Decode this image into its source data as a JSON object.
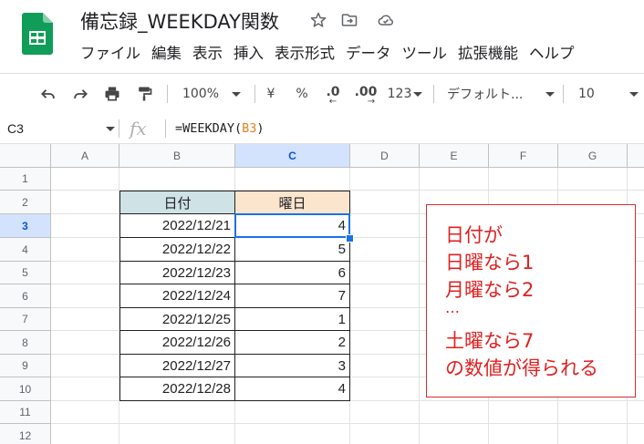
{
  "document": {
    "title": "備忘録_WEEKDAY関数"
  },
  "menu": [
    "ファイル",
    "編集",
    "表示",
    "挿入",
    "表示形式",
    "データ",
    "ツール",
    "拡張機能",
    "ヘルプ"
  ],
  "toolbar": {
    "zoom": "100%",
    "currency": "¥",
    "percent": "%",
    "decrease_decimal": ".0",
    "increase_decimal": ".00",
    "number_format": "123",
    "font": "デフォルト...",
    "font_size": "10"
  },
  "formula_bar": {
    "cell_ref": "C3",
    "fx": "fx",
    "formula_prefix": "=WEEKDAY(",
    "formula_ref": "B3",
    "formula_suffix": ")"
  },
  "columns": [
    "A",
    "B",
    "C",
    "D",
    "E",
    "F",
    "G"
  ],
  "rows": [
    "1",
    "2",
    "3",
    "4",
    "5",
    "6",
    "7",
    "8",
    "9",
    "10",
    "11",
    "12"
  ],
  "table": {
    "headers": [
      "日付",
      "曜日"
    ],
    "header_colors": [
      "#cfe2e5",
      "#fce5cd"
    ],
    "rows": [
      {
        "date": "2022/12/21",
        "weekday": "4"
      },
      {
        "date": "2022/12/22",
        "weekday": "5"
      },
      {
        "date": "2022/12/23",
        "weekday": "6"
      },
      {
        "date": "2022/12/24",
        "weekday": "7"
      },
      {
        "date": "2022/12/25",
        "weekday": "1"
      },
      {
        "date": "2022/12/26",
        "weekday": "2"
      },
      {
        "date": "2022/12/27",
        "weekday": "3"
      },
      {
        "date": "2022/12/28",
        "weekday": "4"
      }
    ]
  },
  "annotation": {
    "lines": [
      "日付が",
      "日曜なら1",
      "月曜なら2",
      "…",
      "土曜なら7",
      "の数値が得られる"
    ]
  },
  "colors": {
    "brand": "#0f9d58",
    "selection": "#1a73e8",
    "annotation_text": "#e02020",
    "annotation_border": "#d32f2f"
  }
}
